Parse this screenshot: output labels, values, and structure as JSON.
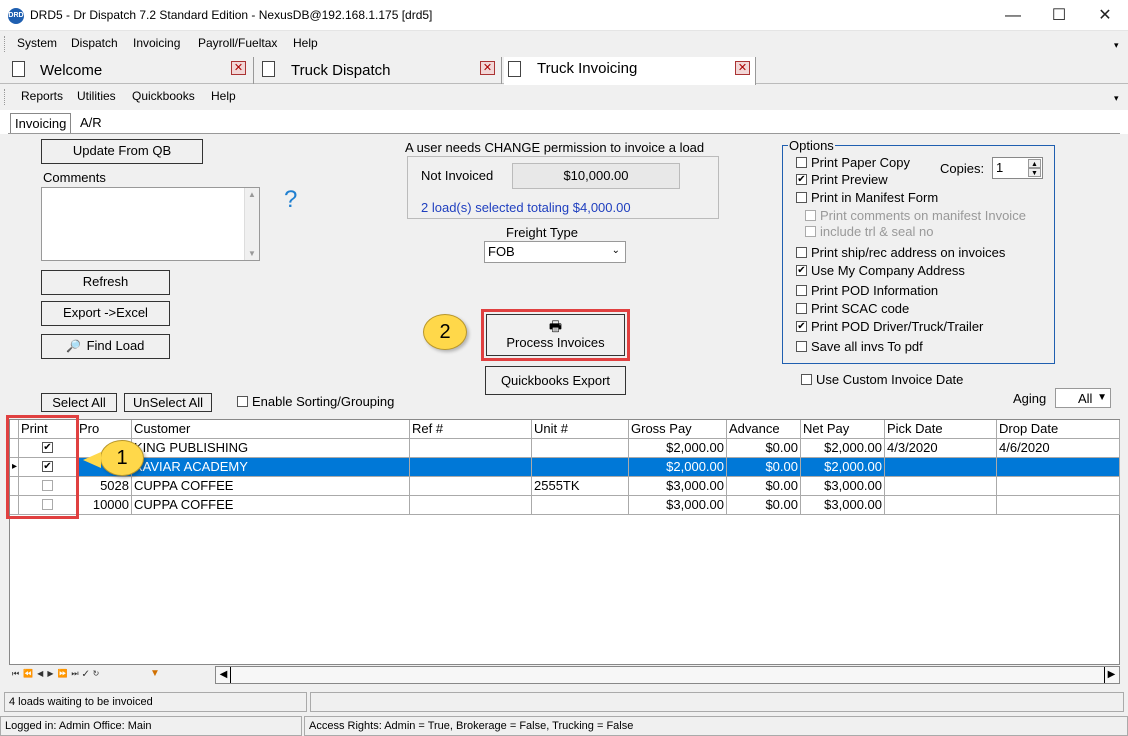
{
  "window": {
    "title": "DRD5 - Dr Dispatch 7.2 Standard Edition - NexusDB@192.168.1.175 [drd5]",
    "icon_text": "DRD",
    "minimize": "—",
    "maximize": "☐",
    "close": "✕"
  },
  "main_menu": [
    "System",
    "Dispatch",
    "Invoicing",
    "Payroll/Fueltax",
    "Help"
  ],
  "form_tabs": [
    "Welcome",
    "Truck Dispatch",
    "Truck Invoicing"
  ],
  "sub_menu": [
    "Reports",
    "Utilities",
    "Quickbooks",
    "Help"
  ],
  "page_tabs": [
    "Invoicing",
    "A/R"
  ],
  "left_panel": {
    "update_qb": "Update From QB",
    "comments_label": "Comments",
    "help": "?",
    "refresh": "Refresh",
    "export_excel": "Export ->Excel",
    "find_load": "Find Load"
  },
  "summary": {
    "permission_note": "A user needs CHANGE permission to invoice a load",
    "not_invoiced_label": "Not Invoiced",
    "not_invoiced_amount": "$10,000.00",
    "selected_text": "2 load(s) selected totaling $4,000.00",
    "freight_type_label": "Freight Type",
    "freight_type_value": "FOB",
    "process_invoices": "Process Invoices",
    "quickbooks_export": "Quickbooks Export"
  },
  "options": {
    "title": "Options",
    "copies_label": "Copies:",
    "copies_value": "1",
    "items": [
      {
        "label": "Print Paper Copy",
        "checked": false,
        "enabled": true
      },
      {
        "label": "Print Preview",
        "checked": true,
        "enabled": true
      },
      {
        "label": "Print in Manifest Form",
        "checked": false,
        "enabled": true
      },
      {
        "label": "Print comments on manifest Invoice",
        "checked": false,
        "enabled": false
      },
      {
        "label": "include trl & seal no",
        "checked": false,
        "enabled": false
      },
      {
        "label": "Print ship/rec address on invoices",
        "checked": false,
        "enabled": true
      },
      {
        "label": "Use My Company Address",
        "checked": true,
        "enabled": true
      },
      {
        "label": "Print POD Information",
        "checked": false,
        "enabled": true
      },
      {
        "label": "Print SCAC code",
        "checked": false,
        "enabled": true
      },
      {
        "label": "Print POD Driver/Truck/Trailer",
        "checked": true,
        "enabled": true
      },
      {
        "label": "Save all invs To pdf",
        "checked": false,
        "enabled": true
      }
    ],
    "use_custom_date": "Use Custom Invoice Date"
  },
  "grid_toolbar": {
    "select_all": "Select All",
    "unselect_all": "UnSelect All",
    "enable_sorting": "Enable Sorting/Grouping",
    "aging_label": "Aging",
    "aging_value": "All"
  },
  "grid": {
    "columns": [
      "Print",
      "Pro",
      "Customer",
      "Ref #",
      "Unit #",
      "Gross Pay",
      "Advance",
      "Net Pay",
      "Pick Date",
      "Drop Date"
    ],
    "rows": [
      {
        "print": true,
        "pro": "",
        "customer": "KING PUBLISHING",
        "ref": "",
        "unit": "",
        "gross": "$2,000.00",
        "advance": "$0.00",
        "net": "$2,000.00",
        "pick": "4/3/2020",
        "drop": "4/6/2020",
        "selected": false
      },
      {
        "print": true,
        "pro": "",
        "customer": "XAVIAR ACADEMY",
        "ref": "",
        "unit": "",
        "gross": "$2,000.00",
        "advance": "$0.00",
        "net": "$2,000.00",
        "pick": "",
        "drop": "",
        "selected": true
      },
      {
        "print": false,
        "pro": "5028",
        "customer": "CUPPA COFFEE",
        "ref": "",
        "unit": "2555TK",
        "gross": "$3,000.00",
        "advance": "$0.00",
        "net": "$3,000.00",
        "pick": "",
        "drop": "",
        "selected": false
      },
      {
        "print": false,
        "pro": "10000",
        "customer": "CUPPA COFFEE",
        "ref": "",
        "unit": "",
        "gross": "$3,000.00",
        "advance": "$0.00",
        "net": "$3,000.00",
        "pick": "",
        "drop": "",
        "selected": false
      }
    ]
  },
  "callouts": {
    "one": "1",
    "two": "2"
  },
  "status": {
    "loads_waiting": "4 loads waiting to be invoiced",
    "logged_in": "Logged in: Admin Office: Main",
    "access_rights": "Access Rights: Admin = True, Brokerage = False, Trucking = False"
  },
  "colors": {
    "selection": "#0078d7",
    "link_blue": "#1f3fbf",
    "callout": "#ffd84a",
    "highlight_box": "#e04040"
  }
}
